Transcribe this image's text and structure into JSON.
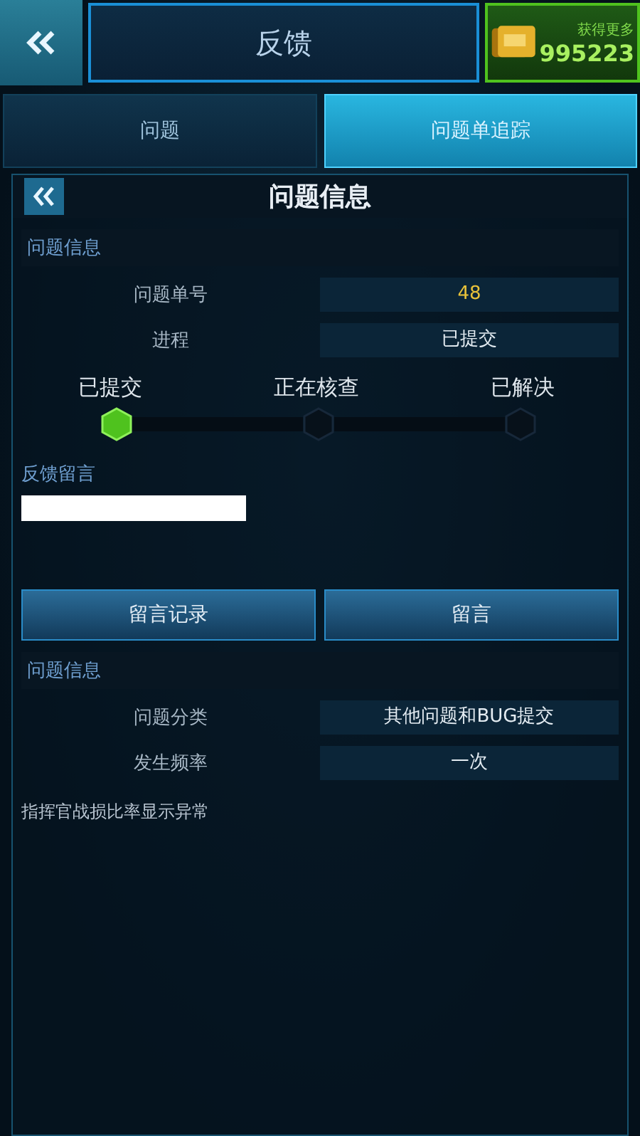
{
  "top_bar": {
    "title": "反馈",
    "currency": {
      "label": "获得更多",
      "amount": "995223"
    }
  },
  "tabs": [
    {
      "label": "问题",
      "selected": false
    },
    {
      "label": "问题单追踪",
      "selected": true
    }
  ],
  "panel": {
    "title": "问题信息",
    "status_section": {
      "heading": "问题信息",
      "rows": [
        {
          "label": "问题单号",
          "value": "48",
          "kind": "number"
        },
        {
          "label": "进程",
          "value": "已提交",
          "kind": "text"
        }
      ],
      "steps": [
        {
          "label": "已提交",
          "done": true
        },
        {
          "label": "正在核查",
          "done": false
        },
        {
          "label": "已解决",
          "done": false
        }
      ]
    },
    "message_section": {
      "heading": "反馈留言"
    },
    "buttons": [
      "留言记录",
      "留言"
    ],
    "detail_section": {
      "heading": "问题信息",
      "rows": [
        {
          "label": "问题分类",
          "value": "其他问题和BUG提交"
        },
        {
          "label": "发生频率",
          "value": "一次"
        }
      ],
      "description": "指挥官战损比率显示异常"
    }
  }
}
